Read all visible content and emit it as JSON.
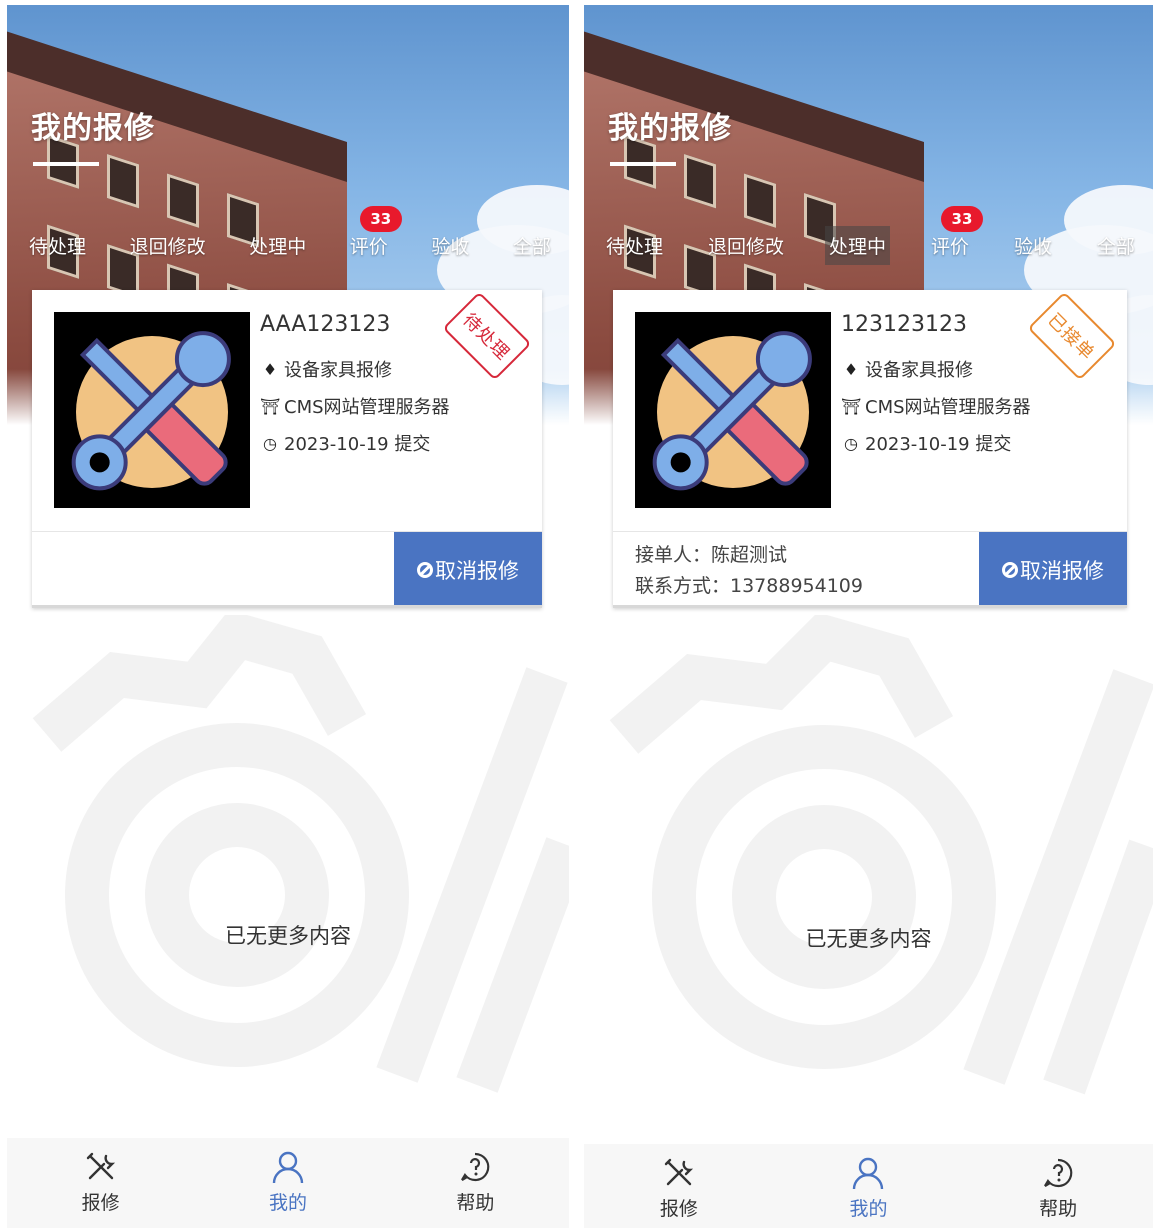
{
  "screens": [
    {
      "page_title": "我的报修",
      "tabs": [
        {
          "label": "待处理"
        },
        {
          "label": "退回修改"
        },
        {
          "label": "处理中"
        },
        {
          "label": "评价",
          "badge": "33"
        },
        {
          "label": "验收"
        },
        {
          "label": "全部"
        }
      ],
      "active_tab": "待处理",
      "card": {
        "order_no": "AAA123123",
        "category": "设备家具报修",
        "location": "CMS网站管理服务器",
        "submitted": "2023-10-19 提交",
        "stamp": "待处理",
        "stamp_color": "#d6283a",
        "cancel_label": "取消报修"
      },
      "no_more": "已无更多内容",
      "nav": [
        {
          "label": "报修",
          "icon": "tools-icon"
        },
        {
          "label": "我的",
          "icon": "user-icon"
        },
        {
          "label": "帮助",
          "icon": "help-icon"
        }
      ],
      "active_nav": "我的"
    },
    {
      "page_title": "我的报修",
      "tabs": [
        {
          "label": "待处理"
        },
        {
          "label": "退回修改"
        },
        {
          "label": "处理中"
        },
        {
          "label": "评价",
          "badge": "33"
        },
        {
          "label": "验收"
        },
        {
          "label": "全部"
        }
      ],
      "active_tab": "处理中",
      "card": {
        "order_no": "123123123",
        "category": "设备家具报修",
        "location": "CMS网站管理服务器",
        "submitted": "2023-10-19 提交",
        "stamp": "已接单",
        "stamp_color": "#e8892f",
        "handler_line": "接单人：陈超测试",
        "contact_line": "联系方式：13788954109",
        "cancel_label": "取消报修"
      },
      "no_more": "已无更多内容",
      "nav": [
        {
          "label": "报修",
          "icon": "tools-icon"
        },
        {
          "label": "我的",
          "icon": "user-icon"
        },
        {
          "label": "帮助",
          "icon": "help-icon"
        }
      ],
      "active_nav": "我的"
    }
  ],
  "colors": {
    "accent": "#4a74c2",
    "badge": "#e8192c"
  }
}
